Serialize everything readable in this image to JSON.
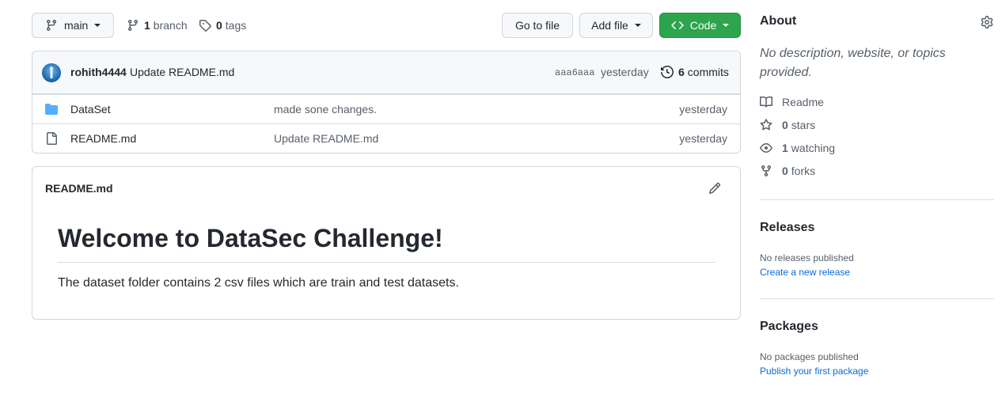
{
  "toolbar": {
    "branch_name": "main",
    "branch_count": "1",
    "branch_label": "branch",
    "tags_count": "0",
    "tags_label": "tags",
    "go_to_file": "Go to file",
    "add_file": "Add file",
    "code": "Code"
  },
  "commit": {
    "author": "rohith4444",
    "message": "Update README.md",
    "sha": "aaa6aaa",
    "time": "yesterday",
    "commit_count": "6",
    "commit_label": "commits"
  },
  "files": [
    {
      "type": "folder",
      "name": "DataSet",
      "message": "made sone changes.",
      "time": "yesterday"
    },
    {
      "type": "file",
      "name": "README.md",
      "message": "Update README.md",
      "time": "yesterday"
    }
  ],
  "readme": {
    "filename": "README.md",
    "heading": "Welcome to DataSec Challenge!",
    "body": "The dataset folder contains 2 csv files which are train and test datasets."
  },
  "about": {
    "title": "About",
    "description": "No description, website, or topics provided.",
    "readme_label": "Readme",
    "stars_count": "0",
    "stars_label": "stars",
    "watching_count": "1",
    "watching_label": "watching",
    "forks_count": "0",
    "forks_label": "forks"
  },
  "releases": {
    "title": "Releases",
    "empty_text": "No releases published",
    "link": "Create a new release"
  },
  "packages": {
    "title": "Packages",
    "empty_text": "No packages published",
    "link": "Publish your first package"
  },
  "colors": {
    "code_button": "#2da44e",
    "link": "#0969da",
    "folder_icon": "#54aeff"
  }
}
